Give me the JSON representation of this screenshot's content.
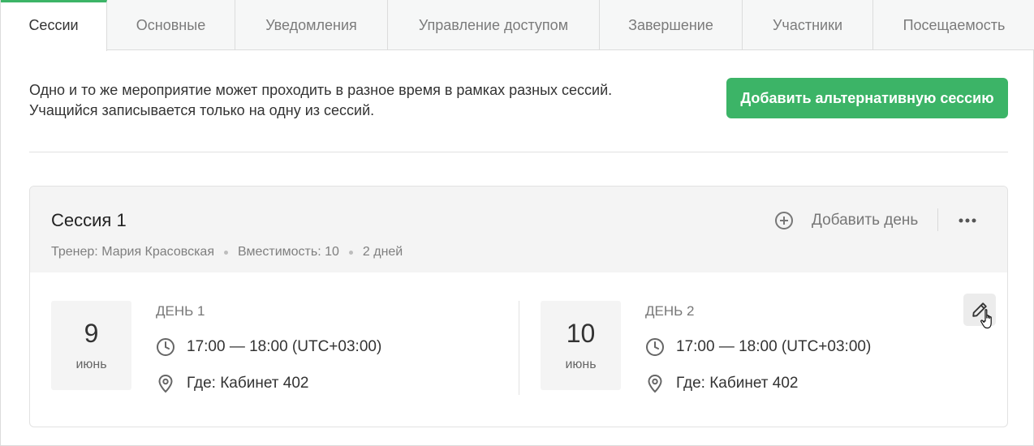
{
  "tabs": [
    {
      "label": "Сессии",
      "active": true
    },
    {
      "label": "Основные",
      "active": false
    },
    {
      "label": "Уведомления",
      "active": false
    },
    {
      "label": "Управление доступом",
      "active": false
    },
    {
      "label": "Завершение",
      "active": false
    },
    {
      "label": "Участники",
      "active": false
    },
    {
      "label": "Посещаемость",
      "active": false
    }
  ],
  "intro": {
    "line1": "Одно и то же мероприятие может проходить в разное время в рамках разных сессий.",
    "line2": "Учащийся записывается только на одну из сессий.",
    "add_button": "Добавить альтернативную сессию"
  },
  "session": {
    "title": "Сессия 1",
    "trainer": "Тренер: Мария Красовская",
    "capacity": "Вместимость: 10",
    "days_count": "2 дней",
    "add_day_label": "Добавить день",
    "more_icon": "more-horizontal-icon",
    "days": [
      {
        "day_num": "9",
        "month": "июнь",
        "label": "ДЕНЬ 1",
        "time": "17:00 — 18:00 (UTC+03:00)",
        "location": "Где: Кабинет 402"
      },
      {
        "day_num": "10",
        "month": "июнь",
        "label": "ДЕНЬ 2",
        "time": "17:00 — 18:00 (UTC+03:00)",
        "location": "Где: Кабинет 402"
      }
    ]
  },
  "colors": {
    "accent": "#3cb467",
    "muted_text": "#7f7f7f",
    "panel_bg": "#f4f4f4"
  }
}
